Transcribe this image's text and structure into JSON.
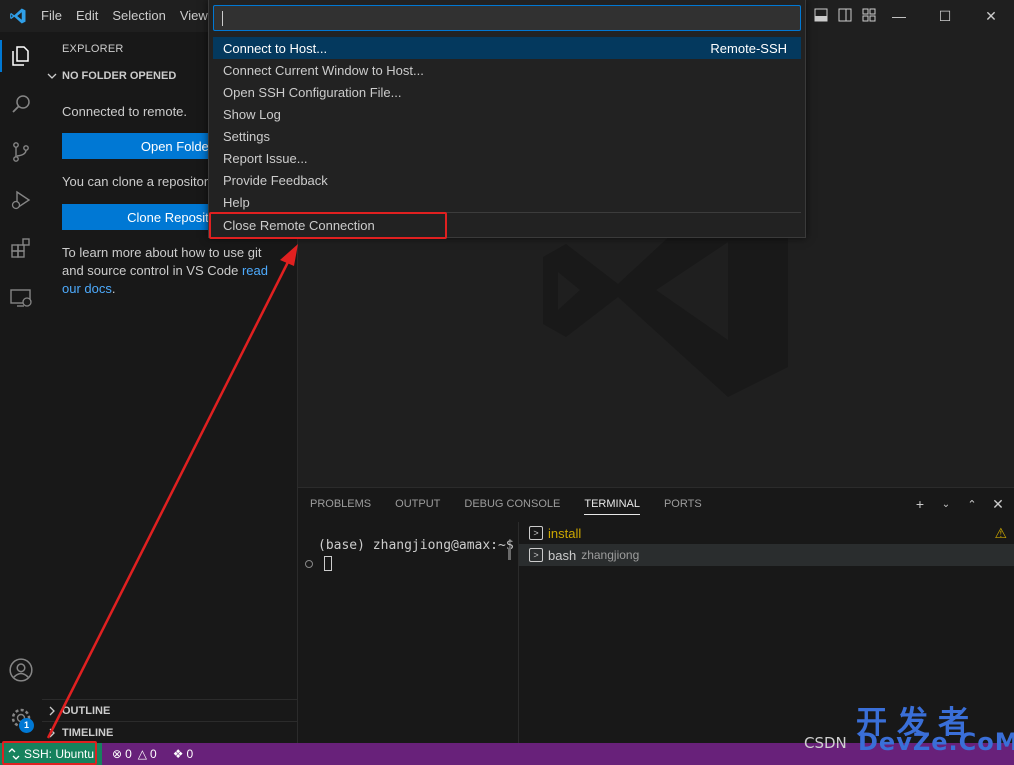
{
  "menubar": [
    "File",
    "Edit",
    "Selection",
    "View"
  ],
  "quickpick": {
    "items": [
      {
        "label": "Connect to Host...",
        "description": "Remote-SSH"
      },
      {
        "label": "Connect Current Window to Host..."
      },
      {
        "label": "Open SSH Configuration File..."
      },
      {
        "label": "Show Log"
      },
      {
        "label": "Settings"
      },
      {
        "label": "Report Issue..."
      },
      {
        "label": "Provide Feedback"
      },
      {
        "label": "Help"
      },
      {
        "label": "Close Remote Connection"
      }
    ]
  },
  "sidebar": {
    "title": "EXPLORER",
    "section": "NO FOLDER OPENED",
    "connected_text": "Connected to remote.",
    "open_folder_label": "Open Folder",
    "clone_text": "You can clone a repository locally.",
    "clone_label": "Clone Repository",
    "learn_text": "To learn more about how to use git and source control in VS Code ",
    "learn_link": "read our docs",
    "learn_end": ".",
    "outline": "OUTLINE",
    "timeline": "TIMELINE"
  },
  "activity": {
    "accounts_badge": "1"
  },
  "panel": {
    "tabs": [
      "PROBLEMS",
      "OUTPUT",
      "DEBUG CONSOLE",
      "TERMINAL",
      "PORTS"
    ],
    "active_tab": "TERMINAL",
    "prompt": "(base) zhangjiong@amax:~$",
    "terminals": [
      {
        "name": "install",
        "sub": "",
        "color": "#cca700"
      },
      {
        "name": "bash",
        "sub": "zhangjiong",
        "color": "#cccccc"
      }
    ]
  },
  "statusbar": {
    "remote": "SSH: Ubuntu",
    "errors": "0",
    "warnings": "0",
    "ports": "0",
    "remote_color": "#16825d",
    "bar_color": "#68217a"
  },
  "watermark": {
    "cn": "开发者",
    "csdn": "CSDN",
    "dev": "DevZe.CoM"
  }
}
